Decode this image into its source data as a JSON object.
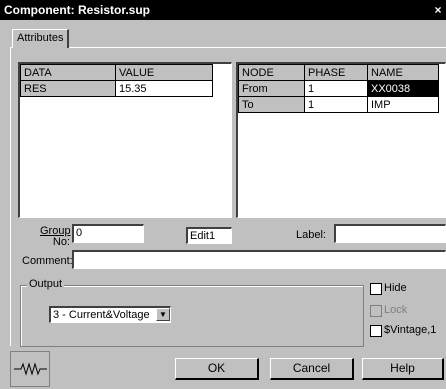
{
  "window": {
    "title": "Component: Resistor.sup",
    "close_glyph": "×"
  },
  "tabs": [
    {
      "label": "Attributes"
    }
  ],
  "data_table": {
    "headers": [
      "DATA",
      "VALUE"
    ],
    "rows": [
      [
        "RES",
        "15.35"
      ]
    ]
  },
  "node_table": {
    "headers": [
      "NODE",
      "PHASE",
      "NAME"
    ],
    "rows": [
      [
        "From",
        "1",
        "XX0038"
      ],
      [
        "To",
        "1",
        "IMP"
      ]
    ]
  },
  "group": {
    "label_line1": "Group",
    "label_line2": "No:",
    "value": "0"
  },
  "edit_box": {
    "value": "Edit1"
  },
  "label_field": {
    "label": "Label:",
    "value": ""
  },
  "comment_field": {
    "label": "Comment:",
    "value": ""
  },
  "output": {
    "caption": "Output",
    "selected": "3 - Current&Voltage"
  },
  "checkboxes": {
    "hide": {
      "label": "Hide",
      "checked": false
    },
    "lock": {
      "label": "Lock",
      "checked": false,
      "disabled": true
    },
    "vintage": {
      "label": "$Vintage,1",
      "checked": false
    }
  },
  "buttons": {
    "ok": "OK",
    "cancel": "Cancel",
    "help": "Help"
  },
  "icon": {
    "name": "resistor-icon"
  }
}
